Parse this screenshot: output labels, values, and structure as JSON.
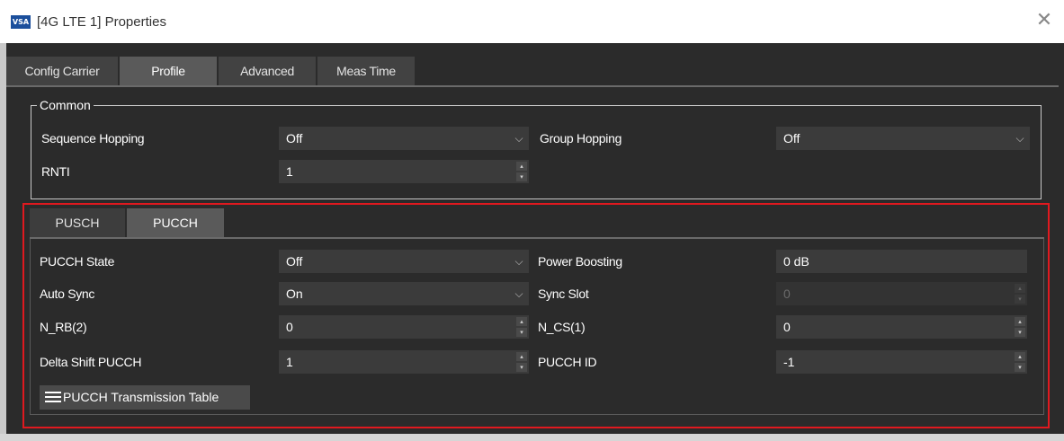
{
  "window": {
    "title": "[4G LTE 1] Properties",
    "app_badge": "VSA",
    "close_glyph": "✕"
  },
  "tabs": [
    {
      "label": "Config Carrier",
      "active": false
    },
    {
      "label": "Profile",
      "active": true
    },
    {
      "label": "Advanced",
      "active": false
    },
    {
      "label": "Meas Time",
      "active": false
    }
  ],
  "common": {
    "legend": "Common",
    "sequence_hopping": {
      "label": "Sequence Hopping",
      "value": "Off"
    },
    "group_hopping": {
      "label": "Group Hopping",
      "value": "Off"
    },
    "rnti": {
      "label": "RNTI",
      "value": "1"
    }
  },
  "subtabs": [
    {
      "label": "PUSCH",
      "active": false
    },
    {
      "label": "PUCCH",
      "active": true
    }
  ],
  "pucch": {
    "state": {
      "label": "PUCCH State",
      "value": "Off"
    },
    "power_boosting": {
      "label": "Power Boosting",
      "value": "0 dB"
    },
    "auto_sync": {
      "label": "Auto Sync",
      "value": "On"
    },
    "sync_slot": {
      "label": "Sync Slot",
      "value": "0",
      "disabled": true
    },
    "n_rb2": {
      "label": "N_RB(2)",
      "value": "0"
    },
    "n_cs1": {
      "label": "N_CS(1)",
      "value": "0"
    },
    "delta_shift": {
      "label": "Delta Shift PUCCH",
      "value": "1"
    },
    "pucch_id": {
      "label": "PUCCH ID",
      "value": "-1"
    },
    "table_button": "PUCCH Transmission Table"
  },
  "icons": {
    "dropdown": "chevron-down-icon",
    "spinner": "spin-arrows-icon",
    "menu": "hamburger-menu-icon"
  },
  "colors": {
    "background": "#2b2b2b",
    "field": "#3b3b3b",
    "highlight": "#e0191f"
  }
}
